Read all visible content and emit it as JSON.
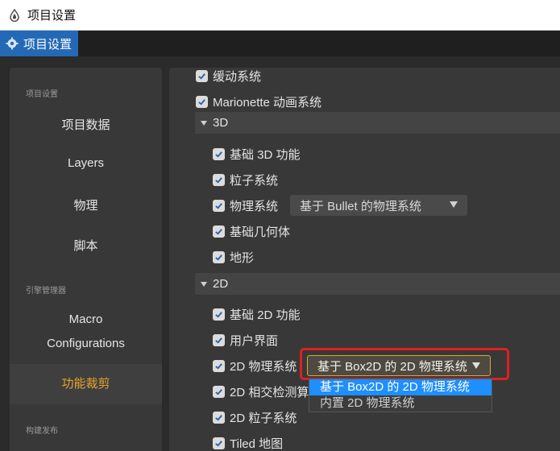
{
  "window": {
    "title": "项目设置"
  },
  "tab": {
    "label": "项目设置",
    "icon": "gear-icon",
    "color": "#2469b5"
  },
  "sidebar": {
    "sections": [
      "项目设置",
      "引擎管理器",
      "构建发布"
    ],
    "items": [
      {
        "label": "项目数据"
      },
      {
        "label": "Layers"
      },
      {
        "label": "物理"
      },
      {
        "label": "脚本"
      },
      {
        "label": "Macro",
        "label2": "Configurations"
      },
      {
        "label": "功能裁剪",
        "active": true
      }
    ],
    "active_color": "#e8a42d"
  },
  "main": {
    "top_rows": [
      "缓动系统",
      "Marionette 动画系统"
    ],
    "group3d": {
      "label": "3D",
      "rows": [
        "基础 3D 功能",
        "粒子系统",
        "物理系统",
        "基础几何体",
        "地形"
      ],
      "physics_select": "基于 Bullet 的物理系统"
    },
    "group2d": {
      "label": "2D",
      "rows": [
        "基础 2D 功能",
        "用户界面",
        "2D 物理系统",
        "2D 相交检测算",
        "2D 粒子系统",
        "Tiled 地图"
      ],
      "physics_select": "基于 Box2D 的 2D 物理系统",
      "dropdown_options": [
        "基于 Box2D 的 2D 物理系统",
        "内置 2D 物理系统"
      ]
    }
  }
}
